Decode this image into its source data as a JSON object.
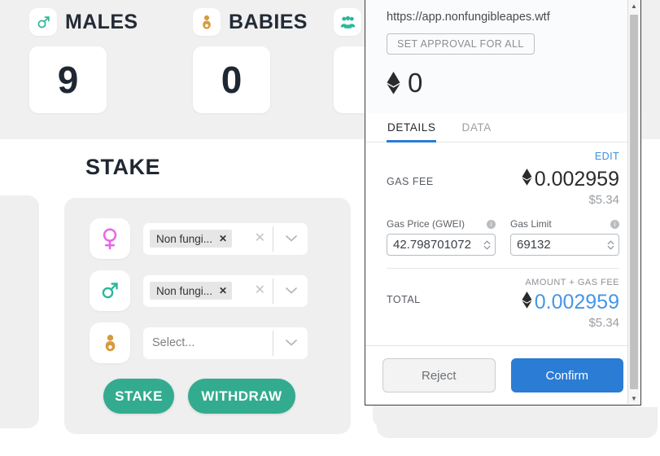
{
  "dapp": {
    "stats": [
      {
        "label": "MALES",
        "value": "9",
        "icon": "male-icon",
        "icon_color": "#2cb89a"
      },
      {
        "label": "BABIES",
        "value": "0",
        "icon": "baby-icon",
        "icon_color": "#d79a3c"
      },
      {
        "label": "",
        "value": "",
        "icon": "group-icon",
        "icon_color": "#2cb89a"
      }
    ],
    "stake": {
      "title": "STAKE",
      "rows": [
        {
          "icon": "female-icon",
          "icon_color": "#e864e8",
          "tag": "Non fungi...",
          "placeholder": "",
          "has_clear": true
        },
        {
          "icon": "male-icon",
          "icon_color": "#2cb89a",
          "tag": "Non fungi...",
          "placeholder": "",
          "has_clear": true
        },
        {
          "icon": "baby-icon",
          "icon_color": "#d79a3c",
          "tag": "",
          "placeholder": "Select...",
          "has_clear": false
        }
      ],
      "stake_button": "STAKE",
      "withdraw_button": "WITHDRAW",
      "accent_color": "#33ab8f"
    }
  },
  "metamask": {
    "origin": "https://app.nonfungibleapes.wtf",
    "approval_button": "SET APPROVAL FOR ALL",
    "amount": "0",
    "tabs": [
      {
        "label": "DETAILS",
        "active": true
      },
      {
        "label": "DATA",
        "active": false
      }
    ],
    "edit_link": "EDIT",
    "gas_fee": {
      "label": "GAS FEE",
      "eth": "0.002959",
      "fiat": "$5.34"
    },
    "gas_price": {
      "label": "Gas Price (GWEI)",
      "value": "42.798701072"
    },
    "gas_limit": {
      "label": "Gas Limit",
      "value": "69132"
    },
    "total": {
      "label": "TOTAL",
      "caption": "AMOUNT + GAS FEE",
      "eth": "0.002959",
      "fiat": "$5.34",
      "color": "#4596e6"
    },
    "reject_button": "Reject",
    "confirm_button": "Confirm",
    "confirm_color": "#2b7cd4"
  }
}
